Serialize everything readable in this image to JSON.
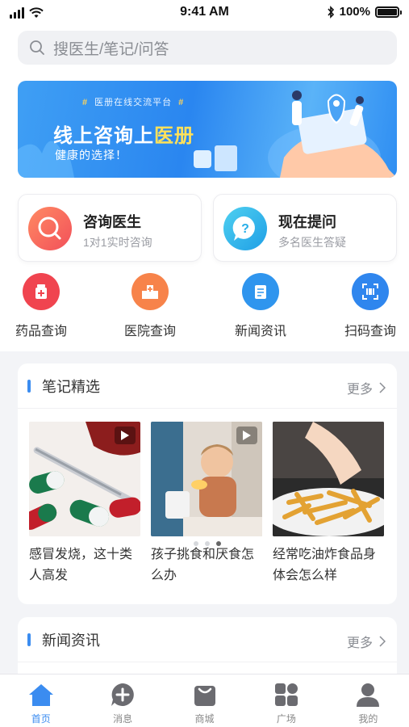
{
  "status_bar": {
    "time": "9:41 AM",
    "battery": "100%"
  },
  "search": {
    "placeholder": "搜医生/笔记/问答"
  },
  "banner": {
    "tag": "医册在线交流平台",
    "title_prefix": "线上咨询上",
    "title_highlight": "医册",
    "subtitle": "健康的选择！"
  },
  "cards": [
    {
      "title": "咨询医生",
      "subtitle": "1对1实时咨询",
      "icon": "magnifier-icon",
      "color": "#f36b56"
    },
    {
      "title": "现在提问",
      "subtitle": "多名医生答疑",
      "icon": "question-bubble-icon",
      "color": "#26aee8"
    }
  ],
  "quick_links": [
    {
      "label": "药品查询",
      "icon": "medicine-icon",
      "color": "#f0444f"
    },
    {
      "label": "医院查询",
      "icon": "hospital-icon",
      "color": "#f7834a"
    },
    {
      "label": "新闻资讯",
      "icon": "news-icon",
      "color": "#2f95ee"
    },
    {
      "label": "扫码查询",
      "icon": "scan-icon",
      "color": "#2f86ee"
    }
  ],
  "notes_section": {
    "title": "笔记精选",
    "more": "更多",
    "items": [
      {
        "title": "感冒发烧，这十类人高发"
      },
      {
        "title": "孩子挑食和厌食怎么办"
      },
      {
        "title": "经常吃油炸食品身体会怎么样"
      }
    ],
    "page_count": 3,
    "active_page": 3
  },
  "news_section": {
    "title": "新闻资讯",
    "more": "更多"
  },
  "tabbar": {
    "active": "首页",
    "items": [
      {
        "label": "首页",
        "icon": "home-icon"
      },
      {
        "label": "消息",
        "icon": "message-plus-icon"
      },
      {
        "label": "商城",
        "icon": "shopping-bag-icon"
      },
      {
        "label": "广场",
        "icon": "grid-icon"
      },
      {
        "label": "我的",
        "icon": "user-icon"
      }
    ]
  },
  "colors": {
    "accent": "#3b8cf0"
  }
}
